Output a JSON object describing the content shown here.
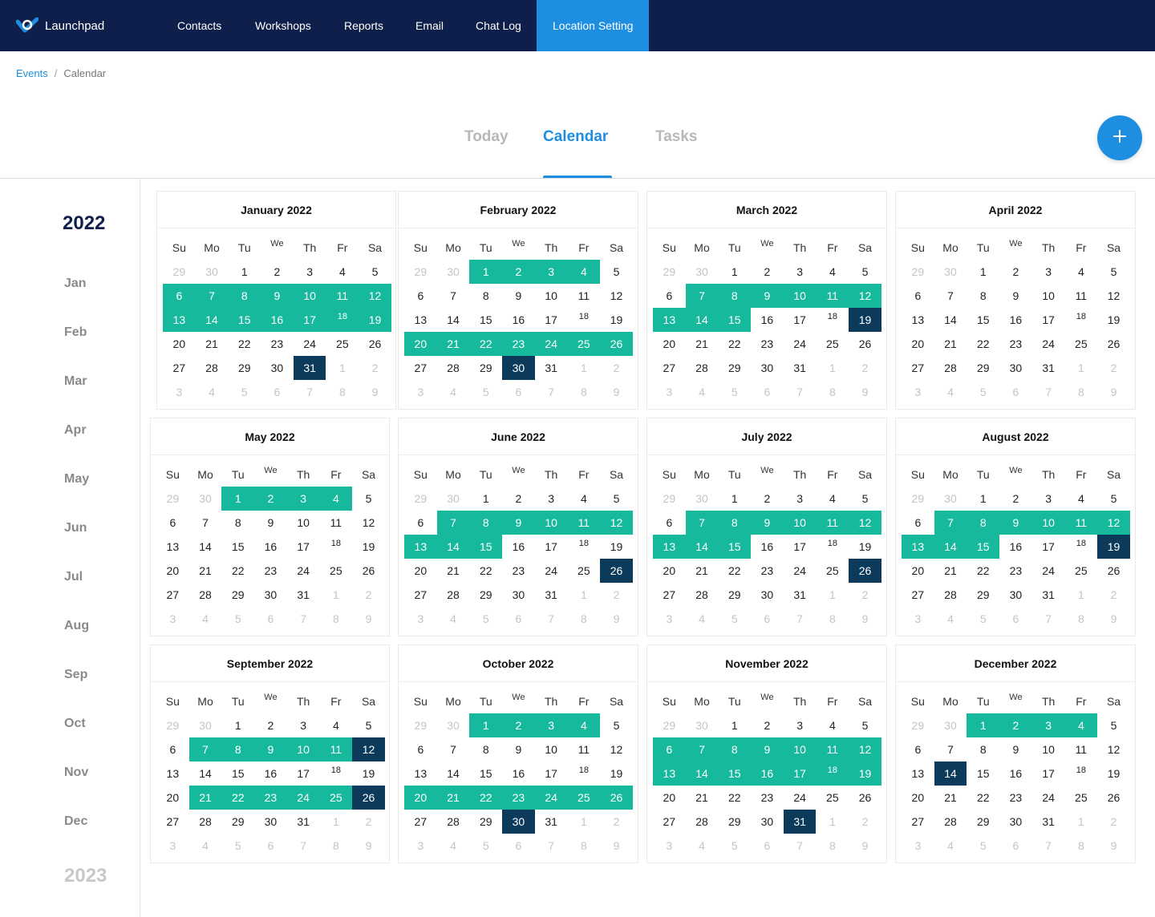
{
  "app": {
    "name": "Launchpad"
  },
  "nav": {
    "items": [
      {
        "label": "Contacts",
        "active": false
      },
      {
        "label": "Workshops",
        "active": false
      },
      {
        "label": "Reports",
        "active": false
      },
      {
        "label": "Email",
        "active": false
      },
      {
        "label": "Chat Log",
        "active": false
      },
      {
        "label": "Location Setting",
        "active": true
      }
    ]
  },
  "breadcrumb": {
    "parent": "Events",
    "separator": "/",
    "current": "Calendar"
  },
  "tabs": [
    {
      "label": "Today",
      "active": false
    },
    {
      "label": "Calendar",
      "active": true
    },
    {
      "label": "Tasks",
      "active": false
    }
  ],
  "fab": {
    "icon": "plus-icon"
  },
  "sidebar": {
    "current_year": "2022",
    "months": [
      "Jan",
      "Feb",
      "Mar",
      "Apr",
      "May",
      "Jun",
      "Jul",
      "Aug",
      "Sep",
      "Oct",
      "Nov",
      "Dec"
    ],
    "next_year": "2023"
  },
  "weekdays": [
    "Su",
    "Mo",
    "Tu",
    "We",
    "Th",
    "Fr",
    "Sa"
  ],
  "colors": {
    "navbar": "#0f1f4b",
    "accent": "#1e8fe0",
    "range": "#17b99d",
    "selected": "#0b3a5b"
  },
  "calendars": [
    {
      "title": "January 2022",
      "weeks": [
        [
          "29",
          "30",
          "1",
          "2",
          "3",
          "4",
          "5"
        ],
        [
          "6",
          "7",
          "8",
          "9",
          "10",
          "11",
          "12"
        ],
        [
          "13",
          "14",
          "15",
          "16",
          "17",
          "18",
          "19"
        ],
        [
          "20",
          "21",
          "22",
          "23",
          "24",
          "25",
          "26"
        ],
        [
          "27",
          "28",
          "29",
          "30",
          "31",
          "1",
          "2"
        ],
        [
          "3",
          "4",
          "5",
          "6",
          "7",
          "8",
          "9"
        ]
      ],
      "leading_muted": 2,
      "trailing_muted": 9,
      "highlighted_ranges": [
        [
          1,
          0,
          6
        ],
        [
          2,
          0,
          6
        ]
      ],
      "selected": [
        [
          4,
          4
        ]
      ]
    },
    {
      "title": "February 2022",
      "weeks": [
        [
          "29",
          "30",
          "1",
          "2",
          "3",
          "4",
          "5"
        ],
        [
          "6",
          "7",
          "8",
          "9",
          "10",
          "11",
          "12"
        ],
        [
          "13",
          "14",
          "15",
          "16",
          "17",
          "18",
          "19"
        ],
        [
          "20",
          "21",
          "22",
          "23",
          "24",
          "25",
          "26"
        ],
        [
          "27",
          "28",
          "29",
          "30",
          "31",
          "1",
          "2"
        ],
        [
          "3",
          "4",
          "5",
          "6",
          "7",
          "8",
          "9"
        ]
      ],
      "leading_muted": 2,
      "trailing_muted": 9,
      "highlighted_ranges": [
        [
          0,
          2,
          5
        ],
        [
          3,
          0,
          6
        ]
      ],
      "selected": [
        [
          4,
          3
        ]
      ]
    },
    {
      "title": "March 2022",
      "weeks": [
        [
          "29",
          "30",
          "1",
          "2",
          "3",
          "4",
          "5"
        ],
        [
          "6",
          "7",
          "8",
          "9",
          "10",
          "11",
          "12"
        ],
        [
          "13",
          "14",
          "15",
          "16",
          "17",
          "18",
          "19"
        ],
        [
          "20",
          "21",
          "22",
          "23",
          "24",
          "25",
          "26"
        ],
        [
          "27",
          "28",
          "29",
          "30",
          "31",
          "1",
          "2"
        ],
        [
          "3",
          "4",
          "5",
          "6",
          "7",
          "8",
          "9"
        ]
      ],
      "leading_muted": 2,
      "trailing_muted": 9,
      "highlighted_ranges": [
        [
          1,
          1,
          6
        ],
        [
          2,
          0,
          2
        ]
      ],
      "selected": [
        [
          2,
          6
        ]
      ]
    },
    {
      "title": "April 2022",
      "weeks": [
        [
          "29",
          "30",
          "1",
          "2",
          "3",
          "4",
          "5"
        ],
        [
          "6",
          "7",
          "8",
          "9",
          "10",
          "11",
          "12"
        ],
        [
          "13",
          "14",
          "15",
          "16",
          "17",
          "18",
          "19"
        ],
        [
          "20",
          "21",
          "22",
          "23",
          "24",
          "25",
          "26"
        ],
        [
          "27",
          "28",
          "29",
          "30",
          "31",
          "1",
          "2"
        ],
        [
          "3",
          "4",
          "5",
          "6",
          "7",
          "8",
          "9"
        ]
      ],
      "leading_muted": 2,
      "trailing_muted": 9,
      "highlighted_ranges": [],
      "selected": []
    },
    {
      "title": "May 2022",
      "weeks": [
        [
          "29",
          "30",
          "1",
          "2",
          "3",
          "4",
          "5"
        ],
        [
          "6",
          "7",
          "8",
          "9",
          "10",
          "11",
          "12"
        ],
        [
          "13",
          "14",
          "15",
          "16",
          "17",
          "18",
          "19"
        ],
        [
          "20",
          "21",
          "22",
          "23",
          "24",
          "25",
          "26"
        ],
        [
          "27",
          "28",
          "29",
          "30",
          "31",
          "1",
          "2"
        ],
        [
          "3",
          "4",
          "5",
          "6",
          "7",
          "8",
          "9"
        ]
      ],
      "leading_muted": 2,
      "trailing_muted": 9,
      "highlighted_ranges": [
        [
          0,
          2,
          5
        ]
      ],
      "selected": []
    },
    {
      "title": "June 2022",
      "weeks": [
        [
          "29",
          "30",
          "1",
          "2",
          "3",
          "4",
          "5"
        ],
        [
          "6",
          "7",
          "8",
          "9",
          "10",
          "11",
          "12"
        ],
        [
          "13",
          "14",
          "15",
          "16",
          "17",
          "18",
          "19"
        ],
        [
          "20",
          "21",
          "22",
          "23",
          "24",
          "25",
          "26"
        ],
        [
          "27",
          "28",
          "29",
          "30",
          "31",
          "1",
          "2"
        ],
        [
          "3",
          "4",
          "5",
          "6",
          "7",
          "8",
          "9"
        ]
      ],
      "leading_muted": 2,
      "trailing_muted": 9,
      "highlighted_ranges": [
        [
          1,
          1,
          6
        ],
        [
          2,
          0,
          2
        ]
      ],
      "selected": [
        [
          3,
          6
        ]
      ]
    },
    {
      "title": "July 2022",
      "weeks": [
        [
          "29",
          "30",
          "1",
          "2",
          "3",
          "4",
          "5"
        ],
        [
          "6",
          "7",
          "8",
          "9",
          "10",
          "11",
          "12"
        ],
        [
          "13",
          "14",
          "15",
          "16",
          "17",
          "18",
          "19"
        ],
        [
          "20",
          "21",
          "22",
          "23",
          "24",
          "25",
          "26"
        ],
        [
          "27",
          "28",
          "29",
          "30",
          "31",
          "1",
          "2"
        ],
        [
          "3",
          "4",
          "5",
          "6",
          "7",
          "8",
          "9"
        ]
      ],
      "leading_muted": 2,
      "trailing_muted": 9,
      "highlighted_ranges": [
        [
          1,
          1,
          6
        ],
        [
          2,
          0,
          2
        ]
      ],
      "selected": [
        [
          3,
          6
        ]
      ]
    },
    {
      "title": "August 2022",
      "weeks": [
        [
          "29",
          "30",
          "1",
          "2",
          "3",
          "4",
          "5"
        ],
        [
          "6",
          "7",
          "8",
          "9",
          "10",
          "11",
          "12"
        ],
        [
          "13",
          "14",
          "15",
          "16",
          "17",
          "18",
          "19"
        ],
        [
          "20",
          "21",
          "22",
          "23",
          "24",
          "25",
          "26"
        ],
        [
          "27",
          "28",
          "29",
          "30",
          "31",
          "1",
          "2"
        ],
        [
          "3",
          "4",
          "5",
          "6",
          "7",
          "8",
          "9"
        ]
      ],
      "leading_muted": 2,
      "trailing_muted": 9,
      "highlighted_ranges": [
        [
          1,
          1,
          6
        ],
        [
          2,
          0,
          2
        ]
      ],
      "selected": [
        [
          2,
          6
        ]
      ]
    },
    {
      "title": "September 2022",
      "weeks": [
        [
          "29",
          "30",
          "1",
          "2",
          "3",
          "4",
          "5"
        ],
        [
          "6",
          "7",
          "8",
          "9",
          "10",
          "11",
          "12"
        ],
        [
          "13",
          "14",
          "15",
          "16",
          "17",
          "18",
          "19"
        ],
        [
          "20",
          "21",
          "22",
          "23",
          "24",
          "25",
          "26"
        ],
        [
          "27",
          "28",
          "29",
          "30",
          "31",
          "1",
          "2"
        ],
        [
          "3",
          "4",
          "5",
          "6",
          "7",
          "8",
          "9"
        ]
      ],
      "leading_muted": 2,
      "trailing_muted": 9,
      "highlighted_ranges": [
        [
          1,
          1,
          5
        ],
        [
          3,
          1,
          5
        ]
      ],
      "selected": [
        [
          1,
          6
        ],
        [
          3,
          6
        ]
      ]
    },
    {
      "title": "October 2022",
      "weeks": [
        [
          "29",
          "30",
          "1",
          "2",
          "3",
          "4",
          "5"
        ],
        [
          "6",
          "7",
          "8",
          "9",
          "10",
          "11",
          "12"
        ],
        [
          "13",
          "14",
          "15",
          "16",
          "17",
          "18",
          "19"
        ],
        [
          "20",
          "21",
          "22",
          "23",
          "24",
          "25",
          "26"
        ],
        [
          "27",
          "28",
          "29",
          "30",
          "31",
          "1",
          "2"
        ],
        [
          "3",
          "4",
          "5",
          "6",
          "7",
          "8",
          "9"
        ]
      ],
      "leading_muted": 2,
      "trailing_muted": 9,
      "highlighted_ranges": [
        [
          0,
          2,
          5
        ],
        [
          3,
          0,
          6
        ]
      ],
      "selected": [
        [
          4,
          3
        ]
      ]
    },
    {
      "title": "November 2022",
      "weeks": [
        [
          "29",
          "30",
          "1",
          "2",
          "3",
          "4",
          "5"
        ],
        [
          "6",
          "7",
          "8",
          "9",
          "10",
          "11",
          "12"
        ],
        [
          "13",
          "14",
          "15",
          "16",
          "17",
          "18",
          "19"
        ],
        [
          "20",
          "21",
          "22",
          "23",
          "24",
          "25",
          "26"
        ],
        [
          "27",
          "28",
          "29",
          "30",
          "31",
          "1",
          "2"
        ],
        [
          "3",
          "4",
          "5",
          "6",
          "7",
          "8",
          "9"
        ]
      ],
      "leading_muted": 2,
      "trailing_muted": 9,
      "highlighted_ranges": [
        [
          1,
          0,
          6
        ],
        [
          2,
          0,
          6
        ]
      ],
      "selected": [
        [
          4,
          4
        ]
      ]
    },
    {
      "title": "December 2022",
      "weeks": [
        [
          "29",
          "30",
          "1",
          "2",
          "3",
          "4",
          "5"
        ],
        [
          "6",
          "7",
          "8",
          "9",
          "10",
          "11",
          "12"
        ],
        [
          "13",
          "14",
          "15",
          "16",
          "17",
          "18",
          "19"
        ],
        [
          "20",
          "21",
          "22",
          "23",
          "24",
          "25",
          "26"
        ],
        [
          "27",
          "28",
          "29",
          "30",
          "31",
          "1",
          "2"
        ],
        [
          "3",
          "4",
          "5",
          "6",
          "7",
          "8",
          "9"
        ]
      ],
      "leading_muted": 2,
      "trailing_muted": 9,
      "highlighted_ranges": [
        [
          0,
          2,
          5
        ]
      ],
      "selected": [
        [
          2,
          1
        ]
      ]
    }
  ]
}
